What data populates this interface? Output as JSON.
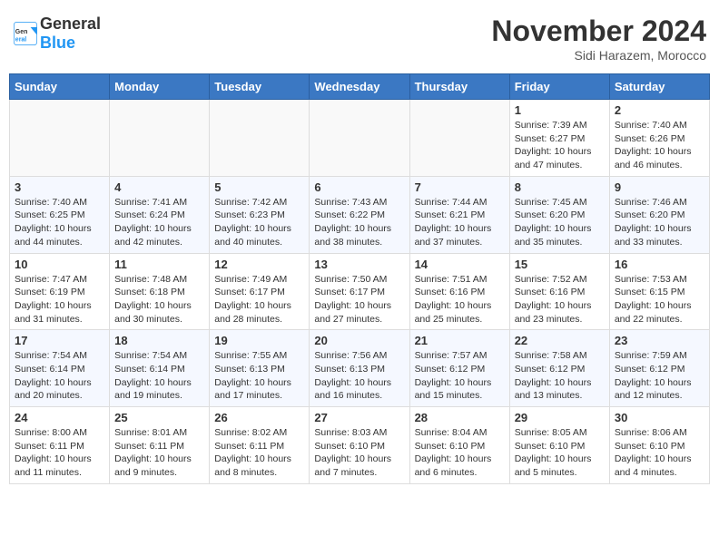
{
  "header": {
    "logo_general": "General",
    "logo_blue": "Blue",
    "month": "November 2024",
    "location": "Sidi Harazem, Morocco"
  },
  "weekdays": [
    "Sunday",
    "Monday",
    "Tuesday",
    "Wednesday",
    "Thursday",
    "Friday",
    "Saturday"
  ],
  "weeks": [
    [
      {
        "day": "",
        "detail": ""
      },
      {
        "day": "",
        "detail": ""
      },
      {
        "day": "",
        "detail": ""
      },
      {
        "day": "",
        "detail": ""
      },
      {
        "day": "",
        "detail": ""
      },
      {
        "day": "1",
        "detail": "Sunrise: 7:39 AM\nSunset: 6:27 PM\nDaylight: 10 hours and 47 minutes."
      },
      {
        "day": "2",
        "detail": "Sunrise: 7:40 AM\nSunset: 6:26 PM\nDaylight: 10 hours and 46 minutes."
      }
    ],
    [
      {
        "day": "3",
        "detail": "Sunrise: 7:40 AM\nSunset: 6:25 PM\nDaylight: 10 hours and 44 minutes."
      },
      {
        "day": "4",
        "detail": "Sunrise: 7:41 AM\nSunset: 6:24 PM\nDaylight: 10 hours and 42 minutes."
      },
      {
        "day": "5",
        "detail": "Sunrise: 7:42 AM\nSunset: 6:23 PM\nDaylight: 10 hours and 40 minutes."
      },
      {
        "day": "6",
        "detail": "Sunrise: 7:43 AM\nSunset: 6:22 PM\nDaylight: 10 hours and 38 minutes."
      },
      {
        "day": "7",
        "detail": "Sunrise: 7:44 AM\nSunset: 6:21 PM\nDaylight: 10 hours and 37 minutes."
      },
      {
        "day": "8",
        "detail": "Sunrise: 7:45 AM\nSunset: 6:20 PM\nDaylight: 10 hours and 35 minutes."
      },
      {
        "day": "9",
        "detail": "Sunrise: 7:46 AM\nSunset: 6:20 PM\nDaylight: 10 hours and 33 minutes."
      }
    ],
    [
      {
        "day": "10",
        "detail": "Sunrise: 7:47 AM\nSunset: 6:19 PM\nDaylight: 10 hours and 31 minutes."
      },
      {
        "day": "11",
        "detail": "Sunrise: 7:48 AM\nSunset: 6:18 PM\nDaylight: 10 hours and 30 minutes."
      },
      {
        "day": "12",
        "detail": "Sunrise: 7:49 AM\nSunset: 6:17 PM\nDaylight: 10 hours and 28 minutes."
      },
      {
        "day": "13",
        "detail": "Sunrise: 7:50 AM\nSunset: 6:17 PM\nDaylight: 10 hours and 27 minutes."
      },
      {
        "day": "14",
        "detail": "Sunrise: 7:51 AM\nSunset: 6:16 PM\nDaylight: 10 hours and 25 minutes."
      },
      {
        "day": "15",
        "detail": "Sunrise: 7:52 AM\nSunset: 6:16 PM\nDaylight: 10 hours and 23 minutes."
      },
      {
        "day": "16",
        "detail": "Sunrise: 7:53 AM\nSunset: 6:15 PM\nDaylight: 10 hours and 22 minutes."
      }
    ],
    [
      {
        "day": "17",
        "detail": "Sunrise: 7:54 AM\nSunset: 6:14 PM\nDaylight: 10 hours and 20 minutes."
      },
      {
        "day": "18",
        "detail": "Sunrise: 7:54 AM\nSunset: 6:14 PM\nDaylight: 10 hours and 19 minutes."
      },
      {
        "day": "19",
        "detail": "Sunrise: 7:55 AM\nSunset: 6:13 PM\nDaylight: 10 hours and 17 minutes."
      },
      {
        "day": "20",
        "detail": "Sunrise: 7:56 AM\nSunset: 6:13 PM\nDaylight: 10 hours and 16 minutes."
      },
      {
        "day": "21",
        "detail": "Sunrise: 7:57 AM\nSunset: 6:12 PM\nDaylight: 10 hours and 15 minutes."
      },
      {
        "day": "22",
        "detail": "Sunrise: 7:58 AM\nSunset: 6:12 PM\nDaylight: 10 hours and 13 minutes."
      },
      {
        "day": "23",
        "detail": "Sunrise: 7:59 AM\nSunset: 6:12 PM\nDaylight: 10 hours and 12 minutes."
      }
    ],
    [
      {
        "day": "24",
        "detail": "Sunrise: 8:00 AM\nSunset: 6:11 PM\nDaylight: 10 hours and 11 minutes."
      },
      {
        "day": "25",
        "detail": "Sunrise: 8:01 AM\nSunset: 6:11 PM\nDaylight: 10 hours and 9 minutes."
      },
      {
        "day": "26",
        "detail": "Sunrise: 8:02 AM\nSunset: 6:11 PM\nDaylight: 10 hours and 8 minutes."
      },
      {
        "day": "27",
        "detail": "Sunrise: 8:03 AM\nSunset: 6:10 PM\nDaylight: 10 hours and 7 minutes."
      },
      {
        "day": "28",
        "detail": "Sunrise: 8:04 AM\nSunset: 6:10 PM\nDaylight: 10 hours and 6 minutes."
      },
      {
        "day": "29",
        "detail": "Sunrise: 8:05 AM\nSunset: 6:10 PM\nDaylight: 10 hours and 5 minutes."
      },
      {
        "day": "30",
        "detail": "Sunrise: 8:06 AM\nSunset: 6:10 PM\nDaylight: 10 hours and 4 minutes."
      }
    ]
  ]
}
